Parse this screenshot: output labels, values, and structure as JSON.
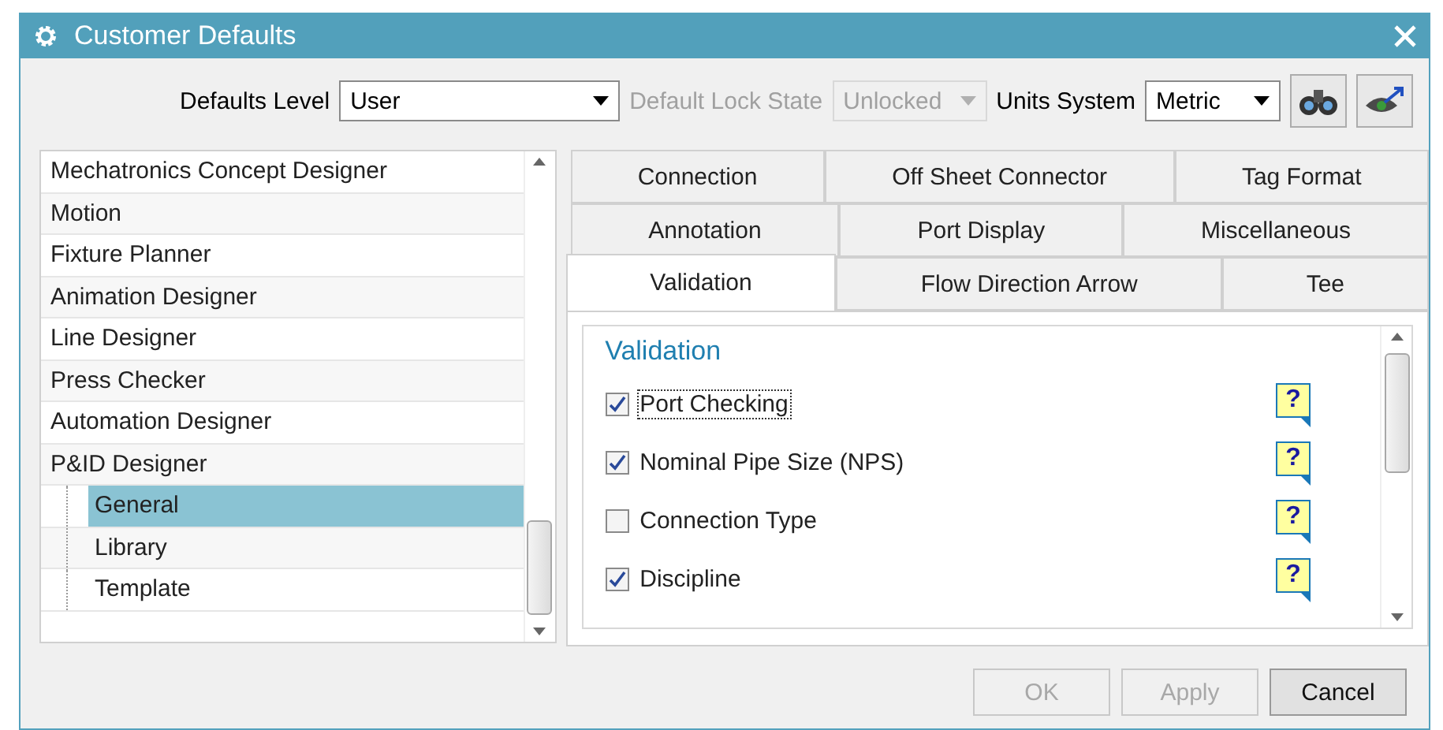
{
  "window": {
    "title": "Customer Defaults"
  },
  "toolbar": {
    "fields": [
      {
        "label": "Defaults Level",
        "value": "User",
        "disabled": false
      },
      {
        "label": "Default Lock State",
        "value": "Unlocked",
        "disabled": true
      },
      {
        "label": "Units System",
        "value": "Metric",
        "disabled": false
      }
    ],
    "icon_buttons": [
      {
        "kind": "binoculars"
      },
      {
        "kind": "eye"
      }
    ]
  },
  "tree": {
    "items": [
      {
        "label": "Mechatronics Concept Designer",
        "selected": false
      },
      {
        "label": "Motion",
        "selected": false
      },
      {
        "label": "Fixture Planner",
        "selected": false
      },
      {
        "label": "Animation Designer",
        "selected": false
      },
      {
        "label": "Line Designer",
        "selected": false
      },
      {
        "label": "Press Checker",
        "selected": false
      },
      {
        "label": "Automation Designer",
        "selected": false
      },
      {
        "label": "P&ID Designer",
        "selected": false,
        "children": [
          {
            "label": "General",
            "selected": true
          },
          {
            "label": "Library",
            "selected": false
          },
          {
            "label": "Template",
            "selected": false
          }
        ]
      }
    ]
  },
  "tab_rows": [
    [
      {
        "label": "Connection",
        "selected": false
      },
      {
        "label": "Off Sheet Connector",
        "selected": false
      },
      {
        "label": "Tag Format",
        "selected": false
      }
    ],
    [
      {
        "label": "Annotation",
        "selected": false
      },
      {
        "label": "Port Display",
        "selected": false
      },
      {
        "label": "Miscellaneous",
        "selected": false
      }
    ],
    [
      {
        "label": "Validation",
        "selected": true
      },
      {
        "label": "Flow Direction Arrow",
        "selected": false
      },
      {
        "label": "Tee",
        "selected": false
      }
    ]
  ],
  "group": {
    "title": "Validation",
    "options": [
      {
        "label": "Port Checking",
        "checked": true,
        "focused": true,
        "help": "?"
      },
      {
        "label": "Nominal Pipe Size (NPS)",
        "checked": true,
        "focused": false,
        "help": "?"
      },
      {
        "label": "Connection Type",
        "checked": false,
        "focused": false,
        "help": "?"
      },
      {
        "label": "Discipline",
        "checked": true,
        "focused": false,
        "help": "?"
      }
    ]
  },
  "buttons": [
    {
      "label": "OK",
      "disabled": true
    },
    {
      "label": "Apply",
      "disabled": true
    },
    {
      "label": "Cancel",
      "disabled": false
    }
  ]
}
